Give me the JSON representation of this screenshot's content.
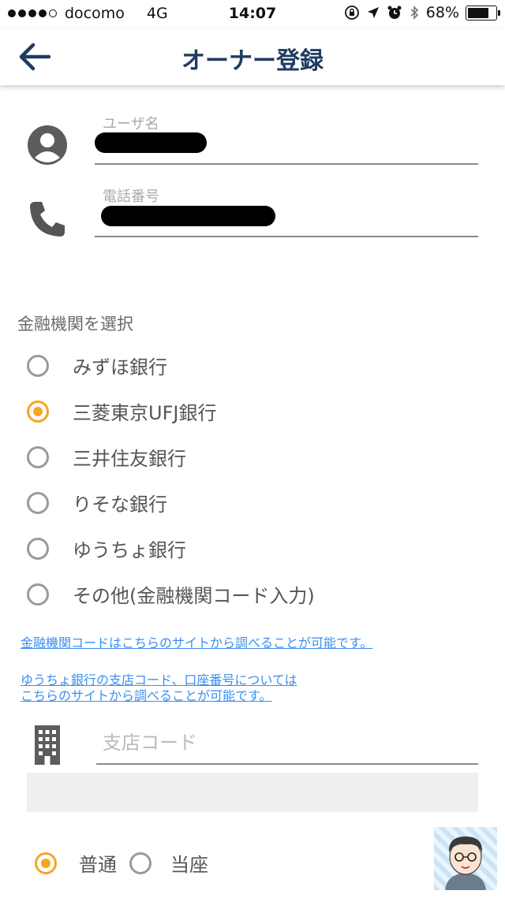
{
  "status_bar": {
    "carrier": "docomo",
    "network": "4G",
    "time": "14:07",
    "battery": "68%"
  },
  "header": {
    "title": "オーナー登録"
  },
  "form": {
    "username_label": "ユーザ名",
    "phone_label": "電話番号",
    "bank_section_label": "金融機関を選択",
    "banks": [
      {
        "label": "みずほ銀行",
        "selected": false
      },
      {
        "label": "三菱東京UFJ銀行",
        "selected": true
      },
      {
        "label": "三井住友銀行",
        "selected": false
      },
      {
        "label": "りそな銀行",
        "selected": false
      },
      {
        "label": "ゆうちょ銀行",
        "selected": false
      },
      {
        "label": "その他(金融機関コード入力)",
        "selected": false
      }
    ],
    "links": {
      "bank_code_link": "金融機関コードはこちらのサイトから調べることが可能です。",
      "yucho_link_line1": "ゆうちょ銀行の支店コード、口座番号については",
      "yucho_link_line2": "こちらのサイトから調べることが可能です。"
    },
    "branch_code_placeholder": "支店コード",
    "account_types": [
      {
        "label": "普通",
        "selected": true
      },
      {
        "label": "当座",
        "selected": false
      }
    ]
  },
  "colors": {
    "accent": "#f5a623",
    "title": "#1f3b63",
    "link": "#3b8ef0"
  }
}
